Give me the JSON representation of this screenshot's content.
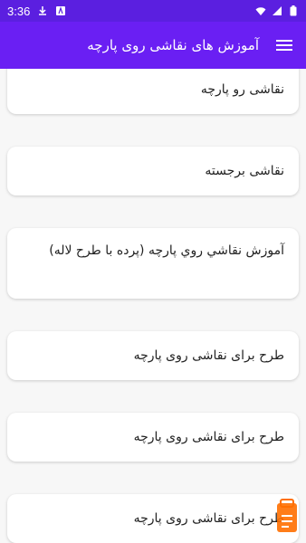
{
  "status_bar": {
    "time": "3:36",
    "icons": [
      "download-icon",
      "app-notification-icon",
      "wifi-icon",
      "signal-icon",
      "battery-icon"
    ]
  },
  "app_bar": {
    "title": "آموزش های نقاشی روی پارچه",
    "menu_icon": "hamburger-menu-icon"
  },
  "items": [
    {
      "label": "نقاشی رو پارچه"
    },
    {
      "label": "نقاشی برجسته"
    },
    {
      "label": "آموزش نقاشي روي پارچه (پرده با طرح لاله)"
    },
    {
      "label": "طرح برای نقاشی روی پارچه"
    },
    {
      "label": "طرح برای نقاشی روی پارچه"
    },
    {
      "label": "طرح برای نقاشی روی پارچه"
    }
  ],
  "colors": {
    "status_bar": "#5b1fe0",
    "app_bar": "#6a1ff3",
    "background": "#f7f7f7",
    "card": "#ffffff",
    "watermark": "#ff6f00"
  }
}
